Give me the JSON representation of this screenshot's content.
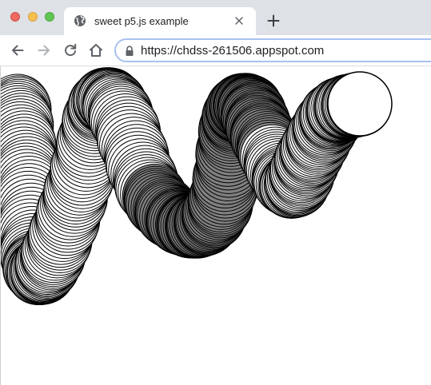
{
  "window": {
    "controls": [
      "close",
      "minimize",
      "zoom"
    ]
  },
  "tabs": [
    {
      "title": "sweet p5.js example",
      "icon": "globe-icon",
      "active": true
    }
  ],
  "new_tab_icon": "plus-icon",
  "toolbar": {
    "back_icon": "arrow-left-icon",
    "forward_icon": "arrow-right-icon",
    "reload_icon": "reload-icon",
    "home_icon": "home-icon"
  },
  "address_bar": {
    "url": "https://chdss-261506.appspot.com",
    "secure_icon": "lock-icon"
  },
  "sketch": {
    "description_colors": {
      "stroke": "#000000",
      "fill_light": "#ffffff",
      "fill_gray": "#808080"
    }
  }
}
